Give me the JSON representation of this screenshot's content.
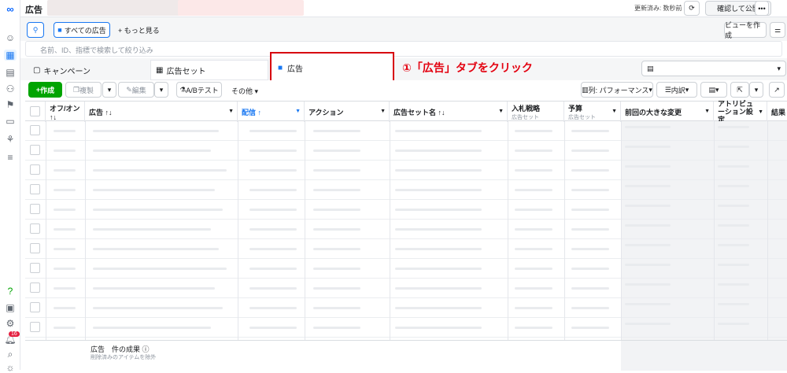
{
  "topbar": {
    "title": "広告",
    "status": "更新済み: 数秒前",
    "review_publish": "確認して公開",
    "more": "•••"
  },
  "subbar": {
    "all_ads": "すべての広告",
    "see_more": "もっと見る",
    "create_view": "ビューを作成"
  },
  "search": {
    "placeholder": "名前、ID、指標で検索して絞り込み"
  },
  "tabs": {
    "campaign": "キャンペーン",
    "adset": "広告セット",
    "ad": "広告"
  },
  "annotation": {
    "text": "①「広告」タブをクリック"
  },
  "toolbar": {
    "create": "作成",
    "duplicate": "複製",
    "edit": "編集",
    "abtest": "A/Bテスト",
    "other": "その他",
    "columns": "列: パフォーマンス",
    "breakdown": "内訳"
  },
  "table": {
    "headers": {
      "onoff": "オフ/オン",
      "onoff_sort": "↑↓",
      "ad": "広告 ↑↓",
      "delivery": "配信 ↑",
      "action": "アクション",
      "adset_name": "広告セット名 ↑↓",
      "bid": "入札戦略",
      "bid_sub": "広告セット",
      "budget": "予算",
      "budget_sub": "広告セット",
      "last_change": "前回の大きな変更",
      "attribution": "アトリビューション設定",
      "results": "結果"
    }
  },
  "footer": {
    "results_label": "広告　件の成果",
    "excluded": "削除済みのアイテムを除外"
  },
  "rail": {
    "badge": "16"
  },
  "colors": {
    "accent": "#1877f2",
    "create_green": "#00a400",
    "callout": "#d7000f"
  }
}
